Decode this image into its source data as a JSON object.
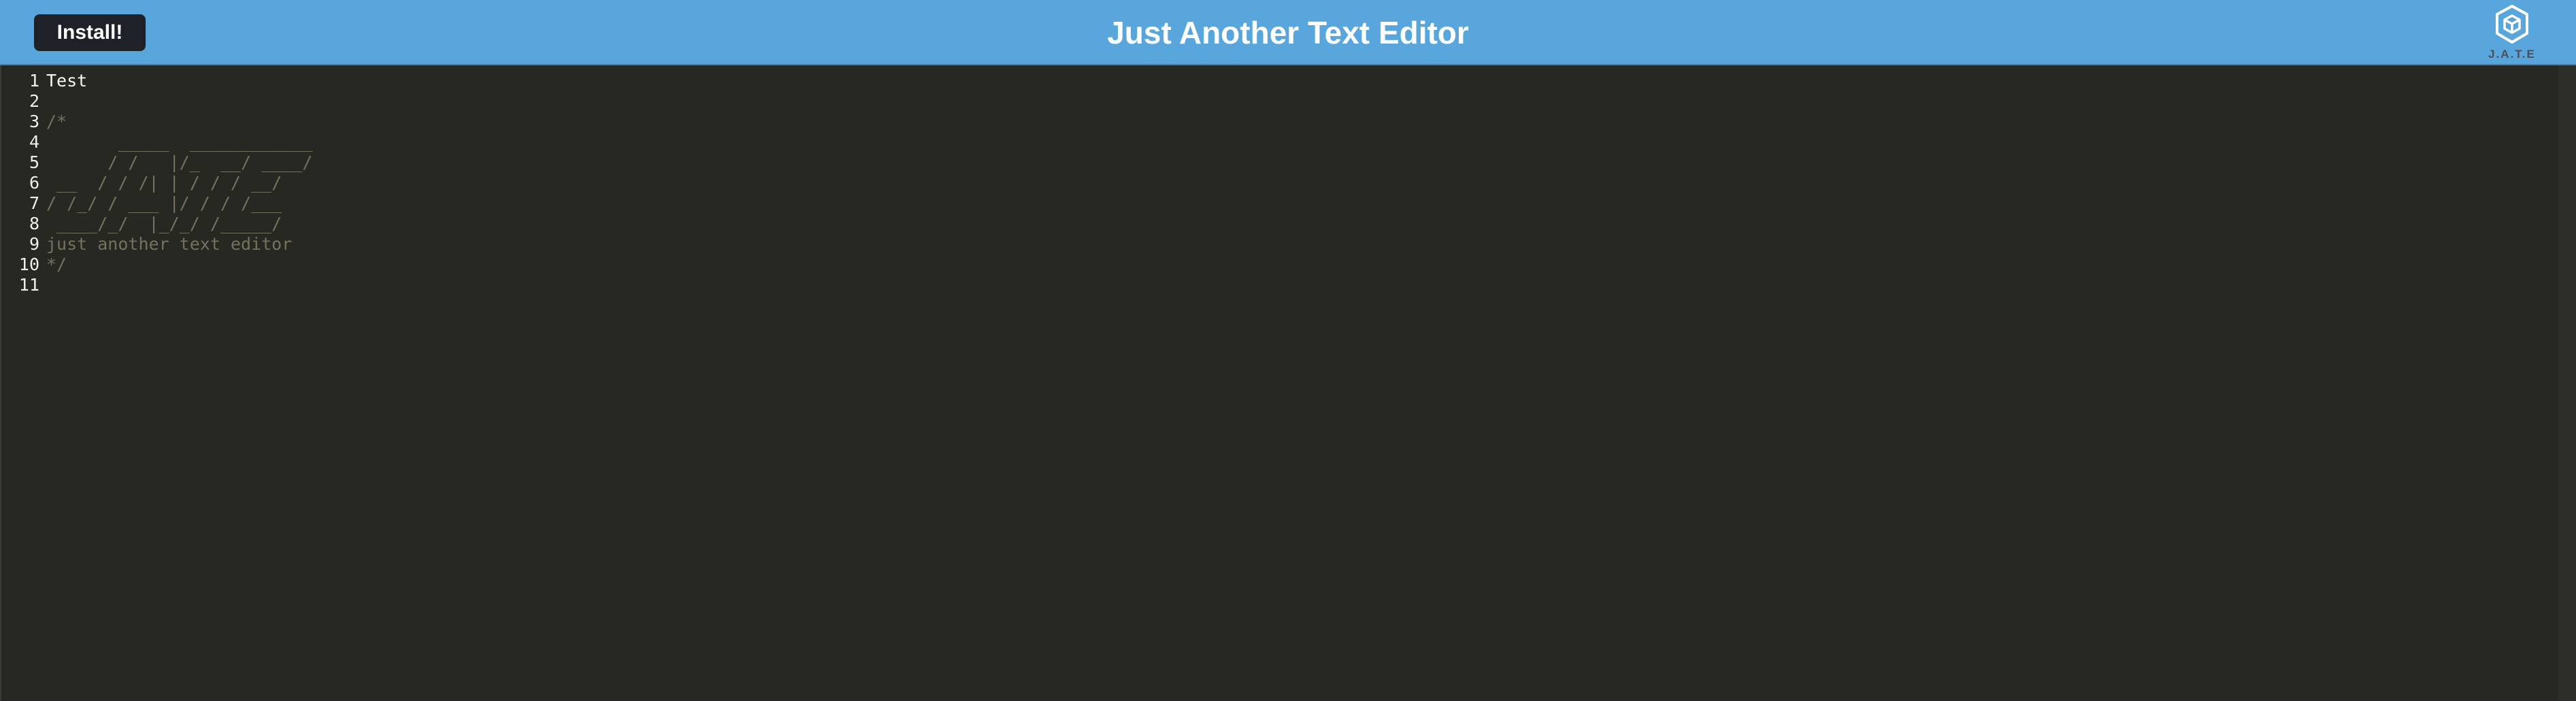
{
  "header": {
    "install_label": "Install!",
    "title": "Just Another Text Editor",
    "logo_text": "J.A.T.E",
    "logo_icon": "cube-icon",
    "background_color": "#58a6dc",
    "button_color": "#1e2127"
  },
  "editor": {
    "background_color": "#272822",
    "comment_color": "#75715e",
    "line_numbers": [
      "1",
      "2",
      "3",
      "4",
      "5",
      "6",
      "7",
      "8",
      "9",
      "10",
      "11"
    ],
    "lines": [
      {
        "text": "Test",
        "kind": "code"
      },
      {
        "text": "",
        "kind": "code"
      },
      {
        "text": "/*",
        "kind": "comment"
      },
      {
        "text": "       _____  ____________",
        "kind": "comment"
      },
      {
        "text": "      / /   |/_  __/ ____/",
        "kind": "comment"
      },
      {
        "text": " __  / / /| | / / / __/",
        "kind": "comment"
      },
      {
        "text": "/ /_/ / ___ |/ / / /___",
        "kind": "comment"
      },
      {
        "text": " ____/_/  |_/_/ /_____/",
        "kind": "comment"
      },
      {
        "text": "just another text editor",
        "kind": "comment"
      },
      {
        "text": "*/",
        "kind": "comment"
      },
      {
        "text": "",
        "kind": "code"
      }
    ]
  }
}
